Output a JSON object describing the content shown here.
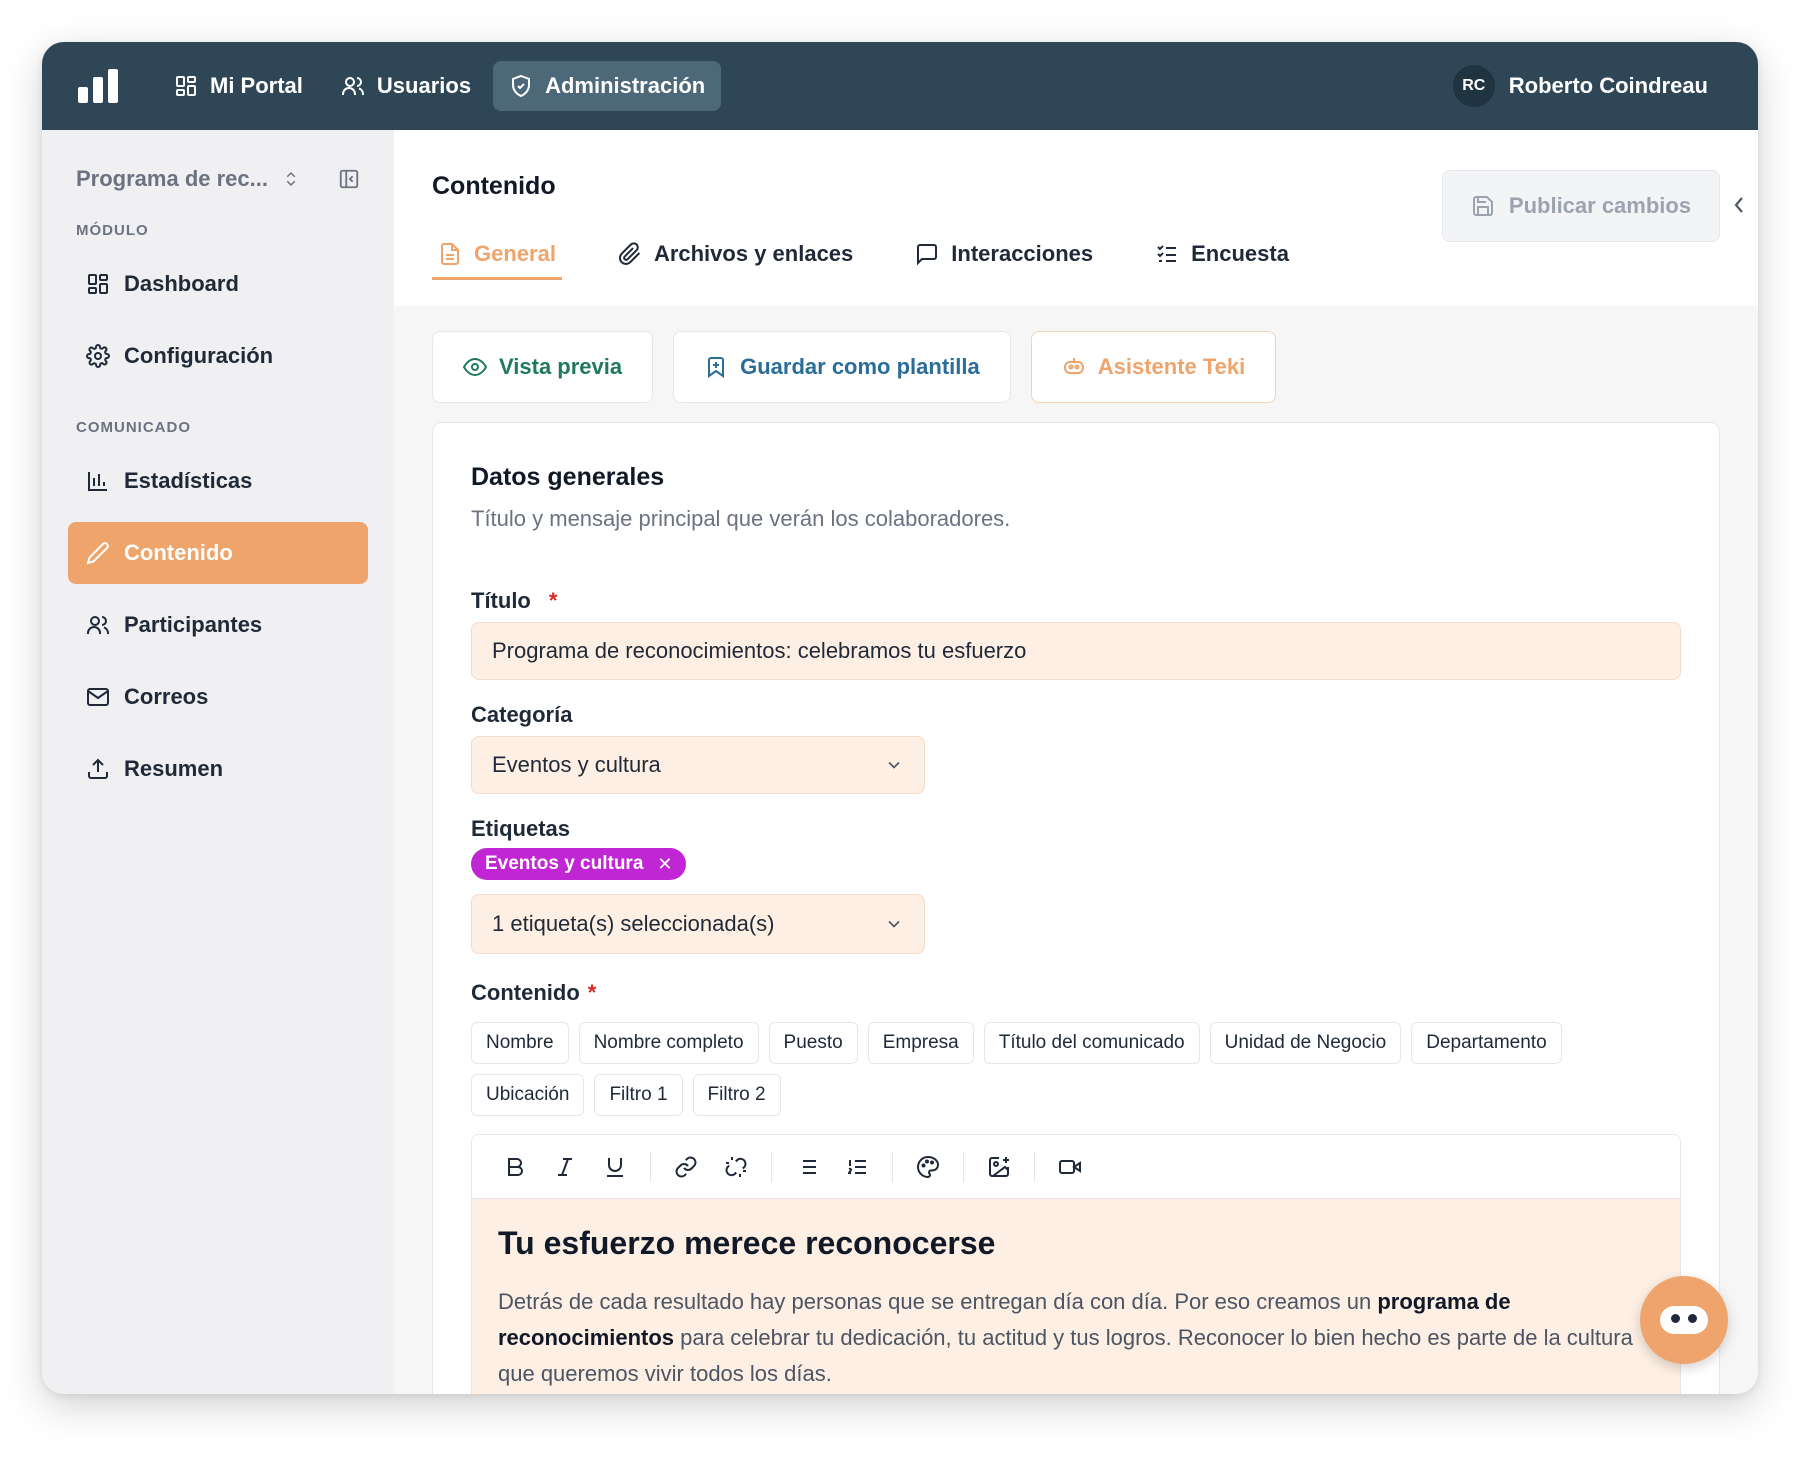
{
  "topbar": {
    "nav": [
      {
        "label": "Mi Portal",
        "icon": "grid-icon"
      },
      {
        "label": "Usuarios",
        "icon": "users-icon"
      },
      {
        "label": "Administración",
        "icon": "shield-icon"
      }
    ],
    "user": {
      "initials": "RC",
      "name": "Roberto Coindreau"
    }
  },
  "sidebar": {
    "program_name": "Programa de rec...",
    "section_module": "MÓDULO",
    "module_items": [
      {
        "label": "Dashboard",
        "icon": "grid-icon"
      },
      {
        "label": "Configuración",
        "icon": "gear-icon"
      }
    ],
    "section_comunicado": "COMUNICADO",
    "comunicado_items": [
      {
        "label": "Estadísticas",
        "icon": "bar-chart-icon"
      },
      {
        "label": "Contenido",
        "icon": "pencil-icon",
        "active": true
      },
      {
        "label": "Participantes",
        "icon": "users-icon"
      },
      {
        "label": "Correos",
        "icon": "mail-icon"
      },
      {
        "label": "Resumen",
        "icon": "upload-icon"
      }
    ]
  },
  "main": {
    "title": "Contenido",
    "publish_label": "Publicar cambios",
    "tabs": [
      {
        "label": "General",
        "icon": "document-icon",
        "active": true
      },
      {
        "label": "Archivos y enlaces",
        "icon": "paperclip-icon"
      },
      {
        "label": "Interacciones",
        "icon": "message-icon"
      },
      {
        "label": "Encuesta",
        "icon": "checklist-icon"
      }
    ],
    "actions": {
      "preview": "Vista previa",
      "save_template": "Guardar como plantilla",
      "assistant": "Asistente Teki"
    },
    "card": {
      "title": "Datos generales",
      "subtitle": "Título y mensaje principal que verán los colaboradores.",
      "title_label": "Título",
      "title_required": "*",
      "title_value": "Programa de reconocimientos: celebramos tu esfuerzo",
      "category_label": "Categoría",
      "category_value": "Eventos y cultura",
      "tags_label": "Etiquetas",
      "tag_chip": "Eventos y cultura",
      "tags_select_value": "1 etiqueta(s) seleccionada(s)",
      "content_label": "Contenido",
      "content_required": "*",
      "variables": [
        "Nombre",
        "Nombre completo",
        "Puesto",
        "Empresa",
        "Título del comunicado",
        "Unidad de Negocio",
        "Departamento",
        "Ubicación",
        "Filtro 1",
        "Filtro 2"
      ],
      "editor_heading": "Tu esfuerzo merece reconocerse",
      "editor_p_1": "Detrás de cada resultado hay personas que se entregan día con día. Por eso creamos un ",
      "editor_p_bold": "programa de reconocimientos",
      "editor_p_2": " para celebrar tu dedicación, tu actitud y tus logros. Reconocer lo bien hecho es parte de la cultura que queremos vivir todos los días."
    }
  },
  "colors": {
    "topbar": "#2f4656",
    "accent": "#eea46a",
    "tag": "#c026d3",
    "field_bg": "#fdefe3"
  }
}
